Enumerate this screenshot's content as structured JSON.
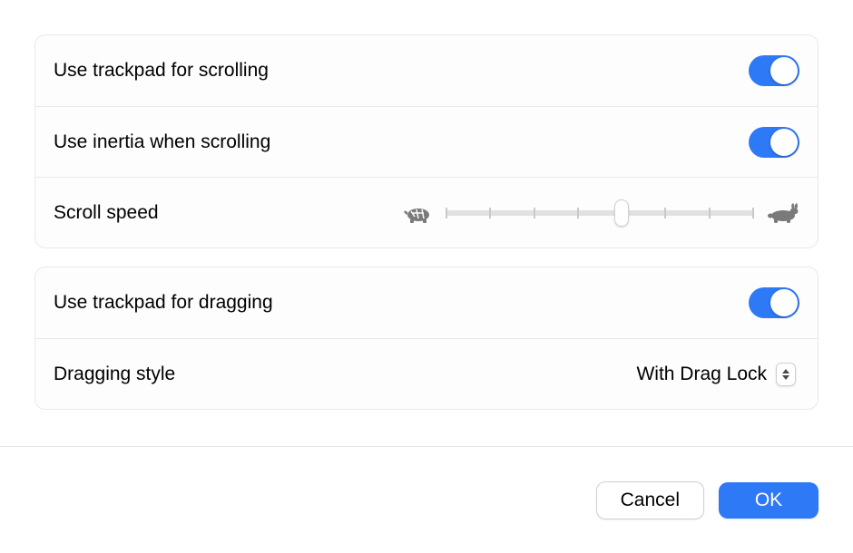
{
  "scrolling": {
    "use_trackpad_label": "Use trackpad for scrolling",
    "use_trackpad_value": true,
    "inertia_label": "Use inertia when scrolling",
    "inertia_value": true,
    "speed_label": "Scroll speed",
    "speed_value": 4,
    "speed_ticks": 8,
    "slow_icon": "tortoise-icon",
    "fast_icon": "hare-icon"
  },
  "dragging": {
    "use_trackpad_label": "Use trackpad for dragging",
    "use_trackpad_value": true,
    "style_label": "Dragging style",
    "style_value": "With Drag Lock"
  },
  "buttons": {
    "cancel": "Cancel",
    "ok": "OK"
  },
  "colors": {
    "accent": "#2e79f6"
  }
}
